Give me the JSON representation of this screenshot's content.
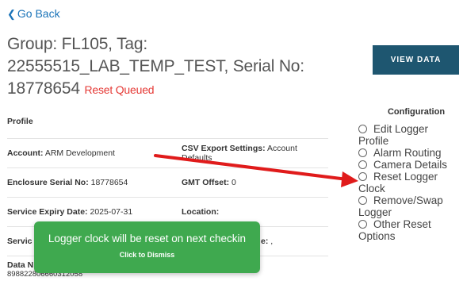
{
  "nav": {
    "back_label": "Go Back"
  },
  "header": {
    "title": "Group: FL105, Tag: 22555515_LAB_TEMP_TEST, Serial No: 18778654",
    "status": "Reset Queued",
    "view_data_label": "VIEW DATA"
  },
  "profile": {
    "label": "Profile",
    "rows": [
      {
        "left_label": "Account:",
        "left_value": "ARM Development",
        "right_label": "CSV Export Settings:",
        "right_value": "Account Defaults"
      },
      {
        "left_label": "Enclosure Serial No:",
        "left_value": "18778654",
        "right_label": "GMT Offset:",
        "right_value": "0"
      },
      {
        "left_label": "Service Expiry Date:",
        "left_value": "2025-07-31",
        "right_label": "Location:",
        "right_value": ""
      },
      {
        "left_label": "Servic",
        "left_value": "",
        "right_label": "e:",
        "right_value": ","
      },
      {
        "left_label": "Data N",
        "left_value": "898822806660312058",
        "right_label": "",
        "right_value": ""
      }
    ]
  },
  "configuration": {
    "title": "Configuration",
    "options": [
      "Edit Logger Profile",
      "Alarm Routing",
      "Camera Details",
      "Reset Logger Clock",
      "Remove/Swap Logger",
      "Other Reset Options"
    ]
  },
  "toast": {
    "message": "Logger clock will be reset on next checkin",
    "dismiss": "Click to Dismiss"
  },
  "colors": {
    "accent": "#1e5670",
    "link": "#1a73b8",
    "status": "#e53935",
    "toast": "#3fa94f",
    "arrow": "#e01b1b"
  },
  "icons": {
    "back": "chevron-left-icon",
    "radio": "radio-unchecked-icon",
    "annotation": "red-arrow"
  }
}
